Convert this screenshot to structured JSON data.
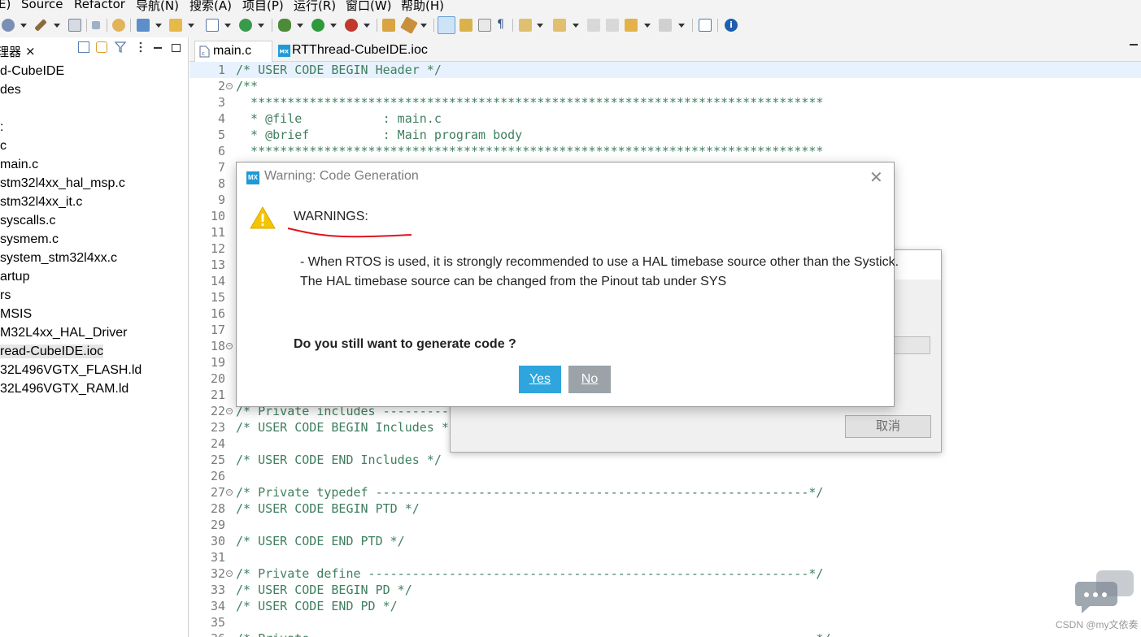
{
  "menu": {
    "items": [
      "E)",
      "Source",
      "Refactor",
      "导航(N)",
      "搜索(A)",
      "项目(P)",
      "运行(R)",
      "窗口(W)",
      "帮助(H)"
    ]
  },
  "toolbar": {
    "icons": [
      "debug-icon",
      "build-icon",
      "binary-icon",
      "skip-icon",
      "hand-icon",
      "new-class-icon",
      "new-folder-icon",
      "new-file-icon",
      "refresh-icon",
      "bug-icon",
      "run-icon",
      "external-tools-icon",
      "open-type-icon",
      "search-icon",
      "highlight-icon",
      "mark-icon",
      "show-whitespace-icon",
      "pilcrow-icon",
      "next-annotation-icon",
      "prev-annotation-icon",
      "back-icon",
      "forward-icon",
      "back-arrow-icon",
      "forward-arrow-icon",
      "pin-icon",
      "info-icon"
    ]
  },
  "project_explorer": {
    "tab_label": "理器",
    "close_glyph": "×",
    "items": [
      "d-CubeIDE",
      "des",
      "",
      ":",
      "c",
      "main.c",
      "stm32l4xx_hal_msp.c",
      "stm32l4xx_it.c",
      "syscalls.c",
      "sysmem.c",
      "system_stm32l4xx.c",
      "artup",
      "rs",
      "MSIS",
      "M32L4xx_HAL_Driver",
      "read-CubeIDE.ioc",
      "32L496VGTX_FLASH.ld",
      "32L496VGTX_RAM.ld"
    ],
    "selected_index": 15
  },
  "editor": {
    "tabs": [
      {
        "label": "main.c",
        "active": true
      },
      {
        "label": "RTThread-CubeIDE.ioc",
        "active": false
      }
    ],
    "lines": [
      {
        "n": "1",
        "text": "/* USER CODE BEGIN Header */",
        "fold": false
      },
      {
        "n": "2",
        "text": "/**",
        "fold": true
      },
      {
        "n": "3",
        "text": "  ******************************************************************************",
        "fold": false
      },
      {
        "n": "4",
        "text": "  * @file           : main.c",
        "fold": false
      },
      {
        "n": "5",
        "text": "  * @brief          : Main program body",
        "fold": false
      },
      {
        "n": "6",
        "text": "  ******************************************************************************",
        "fold": false
      },
      {
        "n": "7",
        "text": "",
        "fold": false
      },
      {
        "n": "8",
        "text": "",
        "fold": false
      },
      {
        "n": "9",
        "text": "",
        "fold": false
      },
      {
        "n": "10",
        "text": "",
        "fold": false
      },
      {
        "n": "11",
        "text": "",
        "fold": false
      },
      {
        "n": "12",
        "text": "",
        "fold": false
      },
      {
        "n": "13",
        "text": "",
        "fold": false
      },
      {
        "n": "14",
        "text": "",
        "fold": false
      },
      {
        "n": "15",
        "text": "",
        "fold": false
      },
      {
        "n": "16",
        "text": "",
        "fold": false
      },
      {
        "n": "17",
        "text": "",
        "fold": false
      },
      {
        "n": "18",
        "text": "",
        "fold": true
      },
      {
        "n": "19",
        "text": "",
        "fold": false
      },
      {
        "n": "20",
        "text": "",
        "fold": false
      },
      {
        "n": "21",
        "text": "",
        "fold": false
      },
      {
        "n": "22",
        "text": "/* Private includes ----------",
        "fold": true
      },
      {
        "n": "23",
        "text": "/* USER CODE BEGIN Includes */",
        "fold": false
      },
      {
        "n": "24",
        "text": "",
        "fold": false
      },
      {
        "n": "25",
        "text": "/* USER CODE END Includes */",
        "fold": false
      },
      {
        "n": "26",
        "text": "",
        "fold": false
      },
      {
        "n": "27",
        "text": "/* Private typedef -----------------------------------------------------------*/",
        "fold": true
      },
      {
        "n": "28",
        "text": "/* USER CODE BEGIN PTD */",
        "fold": false
      },
      {
        "n": "29",
        "text": "",
        "fold": false
      },
      {
        "n": "30",
        "text": "/* USER CODE END PTD */",
        "fold": false
      },
      {
        "n": "31",
        "text": "",
        "fold": false
      },
      {
        "n": "32",
        "text": "/* Private define ------------------------------------------------------------*/",
        "fold": true
      },
      {
        "n": "33",
        "text": "/* USER CODE BEGIN PD */",
        "fold": false
      },
      {
        "n": "34",
        "text": "/* USER CODE END PD */",
        "fold": false
      },
      {
        "n": "35",
        "text": "",
        "fold": false
      },
      {
        "n": "36",
        "text": "/* Private                                                                     */",
        "fold": false
      }
    ]
  },
  "background_dialog": {
    "cancel_label": "取消"
  },
  "warning_dialog": {
    "logo": "MX",
    "title": "Warning: Code Generation",
    "close_glyph": "✕",
    "heading": "WARNINGS:",
    "message_line1": "- When RTOS is used, it is strongly recommended to use a HAL timebase source other than the Systick.",
    "message_line2": "The HAL timebase source can be changed from the Pinout tab under SYS",
    "question": "Do you still want to generate code ?",
    "yes_label": "Yes",
    "no_label": "No"
  },
  "watermark": "CSDN @my文依奏",
  "colors": {
    "comment": "#3f7f5f",
    "yes_button": "#2ea5dc",
    "no_button": "#9ba3a8",
    "annotation_red": "#e0141e",
    "warning_yellow": "#f5c400"
  }
}
